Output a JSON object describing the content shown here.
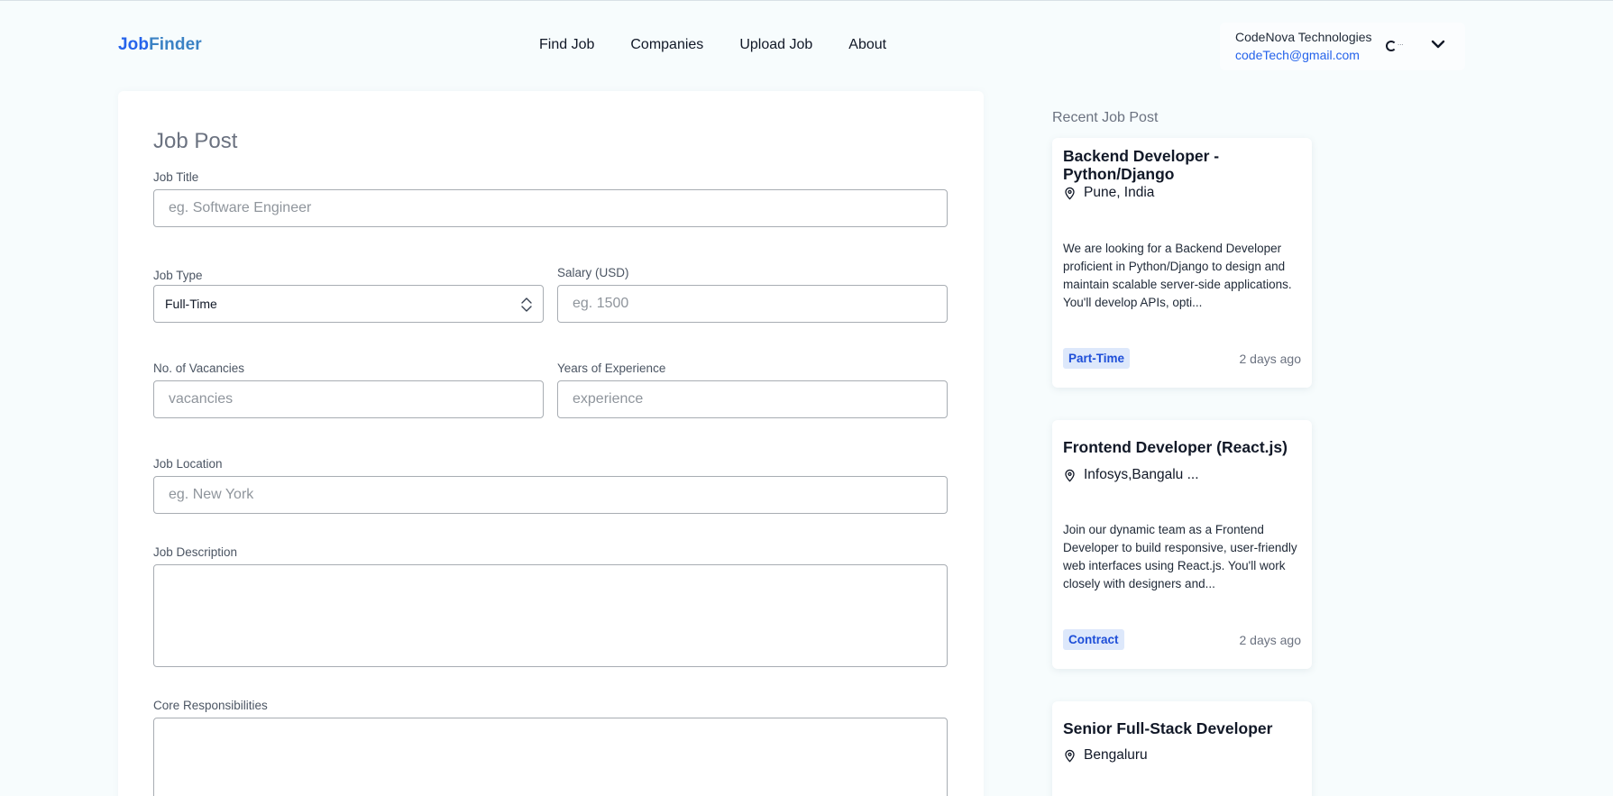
{
  "brand": {
    "part1": "Job",
    "part2": "Finder"
  },
  "nav": [
    {
      "label": "Find Job"
    },
    {
      "label": "Companies"
    },
    {
      "label": "Upload Job"
    },
    {
      "label": "About"
    }
  ],
  "account": {
    "company": "CodeNova Technologies",
    "email": "codeTech@gmail.com",
    "status_text": "..."
  },
  "form": {
    "title": "Job Post",
    "job_title": {
      "label": "Job Title",
      "placeholder": "eg. Software Engineer"
    },
    "job_type": {
      "label": "Job Type",
      "value": "Full-Time"
    },
    "salary": {
      "label": "Salary (USD)",
      "placeholder": "eg. 1500"
    },
    "vacancies": {
      "label": "No. of Vacancies",
      "placeholder": "vacancies"
    },
    "experience": {
      "label": "Years of Experience",
      "placeholder": "experience"
    },
    "location": {
      "label": "Job Location",
      "placeholder": "eg. New York"
    },
    "description": {
      "label": "Job Description"
    },
    "responsibilities": {
      "label": "Core Responsibilities"
    }
  },
  "recent": {
    "title": "Recent Job Post",
    "jobs": [
      {
        "title": "Backend Developer - Python/Django",
        "location": "Pune, India",
        "description": "We are looking for a Backend Developer proficient in Python/Django to design and maintain scalable server-side applications. You'll develop APIs, opti...",
        "type": "Part-Time",
        "posted": "2 days ago"
      },
      {
        "title": "Frontend Developer (React.js)",
        "location": "Infosys,Bangalu ...",
        "description": "Join our dynamic team as a Frontend Developer to build responsive, user-friendly web interfaces using React.js. You'll work closely with designers and...",
        "type": "Contract",
        "posted": "2 days ago"
      },
      {
        "title": "Senior Full-Stack Developer",
        "location": "Bengaluru"
      }
    ]
  },
  "colors": {
    "accent": "#2563eb",
    "badge_bg": "#dde8fb",
    "page_bg": "#f7fcfd"
  }
}
